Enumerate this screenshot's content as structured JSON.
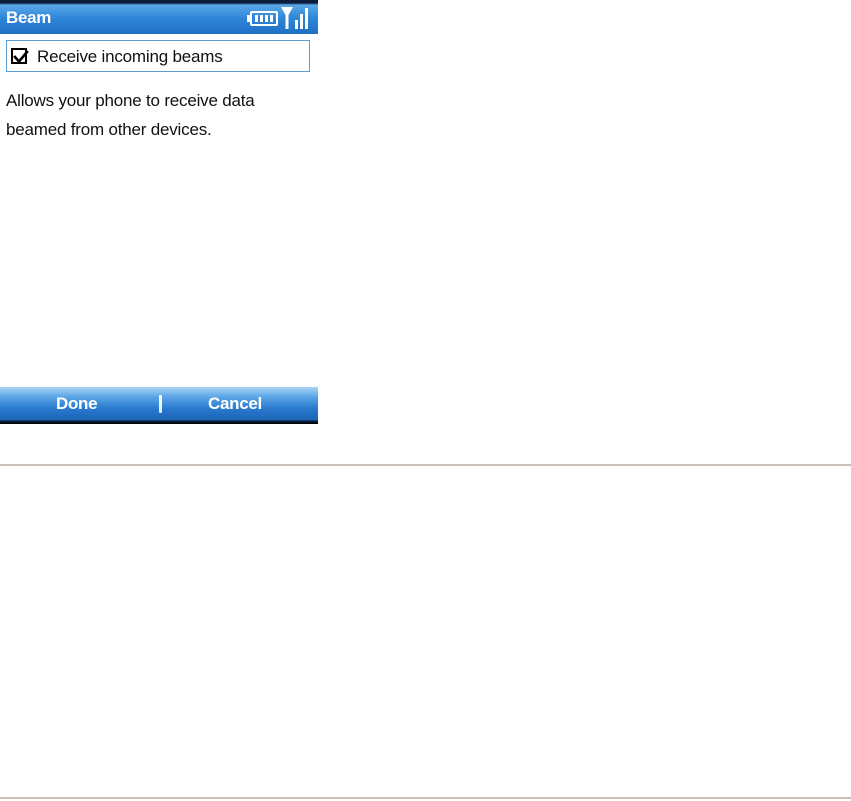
{
  "title_bar": {
    "title": "Beam",
    "icons": [
      "battery-icon",
      "signal-strength-icon"
    ]
  },
  "setting": {
    "checkbox_label": "Receive incoming beams",
    "checked": true
  },
  "description": {
    "line1": "Allows your phone to receive data",
    "line2": "beamed from other devices."
  },
  "softkeys": {
    "left_label": "Done",
    "right_label": "Cancel"
  },
  "colors": {
    "title_bar_blue": "#2f86d8",
    "softkey_bar_blue": "#2878cc",
    "selection_border": "#5a9fd4",
    "rule_gray": "#c9c1b7"
  }
}
